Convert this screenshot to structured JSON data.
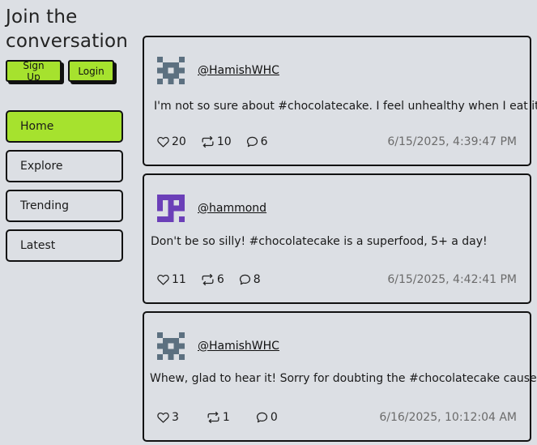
{
  "sidebar": {
    "title": "Join the conversation",
    "signup_label": "Sign Up",
    "login_label": "Login",
    "nav": [
      {
        "label": "Home",
        "active": true
      },
      {
        "label": "Explore",
        "active": false
      },
      {
        "label": "Trending",
        "active": false
      },
      {
        "label": "Latest",
        "active": false
      }
    ]
  },
  "posts": [
    {
      "handle": "@HamishWHC",
      "avatar_color": "#5c7080",
      "text": "I'm not so sure about #chocolatecake. I feel unhealthy when I eat it!",
      "likes": "20",
      "reposts": "10",
      "comments": "6",
      "timestamp": "6/15/2025, 4:39:47 PM"
    },
    {
      "handle": "@hammond",
      "avatar_color": "#6b3fb8",
      "text": "Don't be so silly! #chocolatecake is a superfood, 5+ a day!",
      "likes": "11",
      "reposts": "6",
      "comments": "8",
      "timestamp": "6/15/2025, 4:42:41 PM"
    },
    {
      "handle": "@HamishWHC",
      "avatar_color": "#5c7080",
      "text": "Whew, glad to hear it! Sorry for doubting the #chocolatecake cause!",
      "likes": "3",
      "reposts": "1",
      "comments": "0",
      "timestamp": "6/16/2025, 10:12:04 AM"
    }
  ],
  "icons": {
    "like": "heart-icon",
    "repost": "repost-icon",
    "comment": "comment-icon"
  }
}
